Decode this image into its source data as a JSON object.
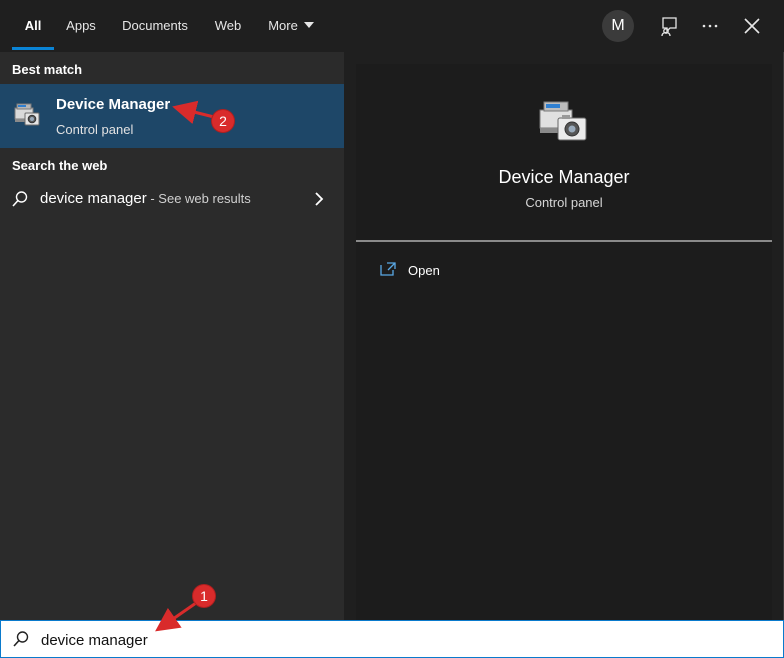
{
  "tabs": [
    {
      "label": "All"
    },
    {
      "label": "Apps"
    },
    {
      "label": "Documents"
    },
    {
      "label": "Web"
    },
    {
      "label": "More"
    }
  ],
  "toolbar": {
    "avatar_initial": "M",
    "feedback_icon": "feedback-icon",
    "more_icon": "ellipsis-icon",
    "close_icon": "close-icon"
  },
  "results": {
    "best_match_heading": "Best match",
    "best_match": {
      "title": "Device Manager",
      "subtitle": "Control panel",
      "icon": "device-manager-icon"
    },
    "web_heading": "Search the web",
    "web_result": {
      "query": "device manager",
      "suffix": " - See web results"
    }
  },
  "preview": {
    "title": "Device Manager",
    "subtitle": "Control panel",
    "actions": [
      {
        "label": "Open",
        "icon": "open-icon"
      }
    ]
  },
  "search": {
    "value": "device manager",
    "icon": "search-icon"
  },
  "annotations": [
    {
      "number": "1",
      "color": "#d92b2b"
    },
    {
      "number": "2",
      "color": "#d92b2b"
    }
  ],
  "colors": {
    "accent": "#0a84d6",
    "selected_bg": "#1e4768",
    "annotation_red": "#d92b2b"
  }
}
